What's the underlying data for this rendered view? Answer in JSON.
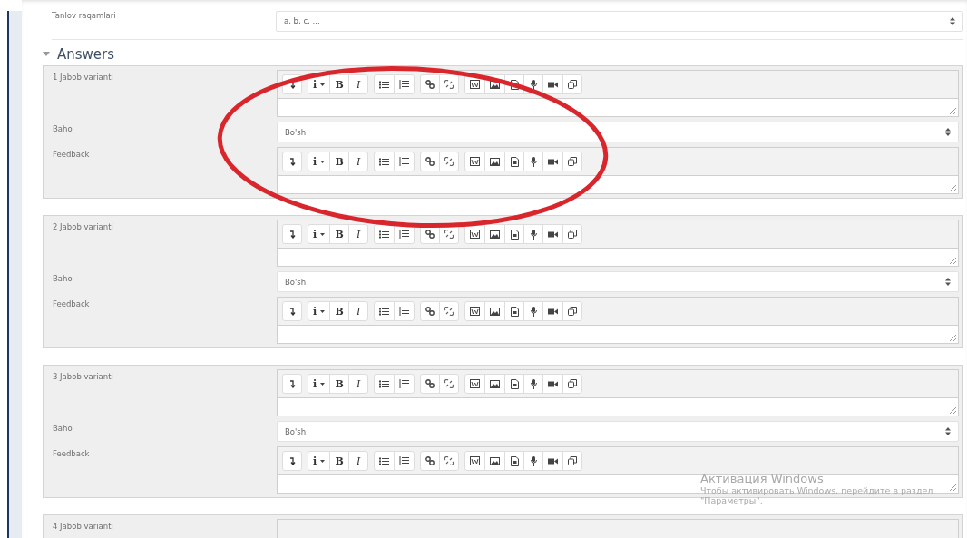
{
  "top_field": {
    "label": "Tanlov raqamlari",
    "value": "a, b, c, ..."
  },
  "section": {
    "title": "Answers",
    "expanded": true
  },
  "answers": [
    {
      "label": "1 Jabob varianti",
      "toolbar": [
        [
          {
            "kind": "collapse"
          }
        ],
        [
          {
            "kind": "info",
            "label": "i"
          },
          {
            "kind": "bold",
            "label": "B"
          },
          {
            "kind": "italic",
            "label": "I"
          }
        ],
        [
          {
            "kind": "ul"
          },
          {
            "kind": "ol"
          }
        ],
        [
          {
            "kind": "link"
          },
          {
            "kind": "unlink"
          }
        ],
        [
          {
            "kind": "word"
          },
          {
            "kind": "image"
          },
          {
            "kind": "file"
          },
          {
            "kind": "mic"
          },
          {
            "kind": "video"
          },
          {
            "kind": "copy"
          }
        ]
      ],
      "grade": {
        "label": "Baho",
        "value": "Bo'sh"
      },
      "feedback": {
        "label": "Feedback",
        "toolbar": [
          [
            {
              "kind": "collapse"
            }
          ],
          [
            {
              "kind": "info",
              "label": "i"
            },
            {
              "kind": "bold",
              "label": "B"
            },
            {
              "kind": "italic",
              "label": "I"
            }
          ],
          [
            {
              "kind": "ul"
            },
            {
              "kind": "ol"
            }
          ],
          [
            {
              "kind": "link"
            },
            {
              "kind": "unlink"
            }
          ],
          [
            {
              "kind": "word"
            },
            {
              "kind": "image"
            },
            {
              "kind": "file"
            },
            {
              "kind": "mic"
            },
            {
              "kind": "video"
            },
            {
              "kind": "copy"
            }
          ]
        ]
      }
    },
    {
      "label": "2 Jabob varianti",
      "toolbar": [
        [
          {
            "kind": "collapse"
          }
        ],
        [
          {
            "kind": "info",
            "label": "i"
          },
          {
            "kind": "bold",
            "label": "B"
          },
          {
            "kind": "italic",
            "label": "I"
          }
        ],
        [
          {
            "kind": "ul"
          },
          {
            "kind": "ol"
          }
        ],
        [
          {
            "kind": "link"
          },
          {
            "kind": "unlink"
          }
        ],
        [
          {
            "kind": "word"
          },
          {
            "kind": "image"
          },
          {
            "kind": "file"
          },
          {
            "kind": "mic"
          },
          {
            "kind": "video"
          },
          {
            "kind": "copy"
          }
        ]
      ],
      "grade": {
        "label": "Baho",
        "value": "Bo'sh"
      },
      "feedback": {
        "label": "Feedback",
        "toolbar": [
          [
            {
              "kind": "collapse"
            }
          ],
          [
            {
              "kind": "info",
              "label": "i"
            },
            {
              "kind": "bold",
              "label": "B"
            },
            {
              "kind": "italic",
              "label": "I"
            }
          ],
          [
            {
              "kind": "ul"
            },
            {
              "kind": "ol"
            }
          ],
          [
            {
              "kind": "link"
            },
            {
              "kind": "unlink"
            }
          ],
          [
            {
              "kind": "word"
            },
            {
              "kind": "image"
            },
            {
              "kind": "file"
            },
            {
              "kind": "mic"
            },
            {
              "kind": "video"
            },
            {
              "kind": "copy"
            }
          ]
        ]
      }
    },
    {
      "label": "3 Jabob varianti",
      "toolbar": [
        [
          {
            "kind": "collapse"
          }
        ],
        [
          {
            "kind": "info",
            "label": "i"
          },
          {
            "kind": "bold",
            "label": "B"
          },
          {
            "kind": "italic",
            "label": "I"
          }
        ],
        [
          {
            "kind": "ul"
          },
          {
            "kind": "ol"
          }
        ],
        [
          {
            "kind": "link"
          },
          {
            "kind": "unlink"
          }
        ],
        [
          {
            "kind": "word"
          },
          {
            "kind": "image"
          },
          {
            "kind": "file"
          },
          {
            "kind": "mic"
          },
          {
            "kind": "video"
          },
          {
            "kind": "copy"
          }
        ]
      ],
      "grade": {
        "label": "Baho",
        "value": "Bo'sh"
      },
      "feedback": {
        "label": "Feedback",
        "toolbar": [
          [
            {
              "kind": "collapse"
            }
          ],
          [
            {
              "kind": "info",
              "label": "i"
            },
            {
              "kind": "bold",
              "label": "B"
            },
            {
              "kind": "italic",
              "label": "I"
            }
          ],
          [
            {
              "kind": "ul"
            },
            {
              "kind": "ol"
            }
          ],
          [
            {
              "kind": "link"
            },
            {
              "kind": "unlink"
            }
          ],
          [
            {
              "kind": "word"
            },
            {
              "kind": "image"
            },
            {
              "kind": "file"
            },
            {
              "kind": "mic"
            },
            {
              "kind": "video"
            },
            {
              "kind": "copy"
            }
          ]
        ]
      }
    },
    {
      "label": "4 Jabob varianti"
    }
  ],
  "os_notice": {
    "title": "Активация Windows",
    "lines": [
      "Чтобы активировать Windows, перейдите в раздел",
      "\"Параметры\"."
    ]
  }
}
